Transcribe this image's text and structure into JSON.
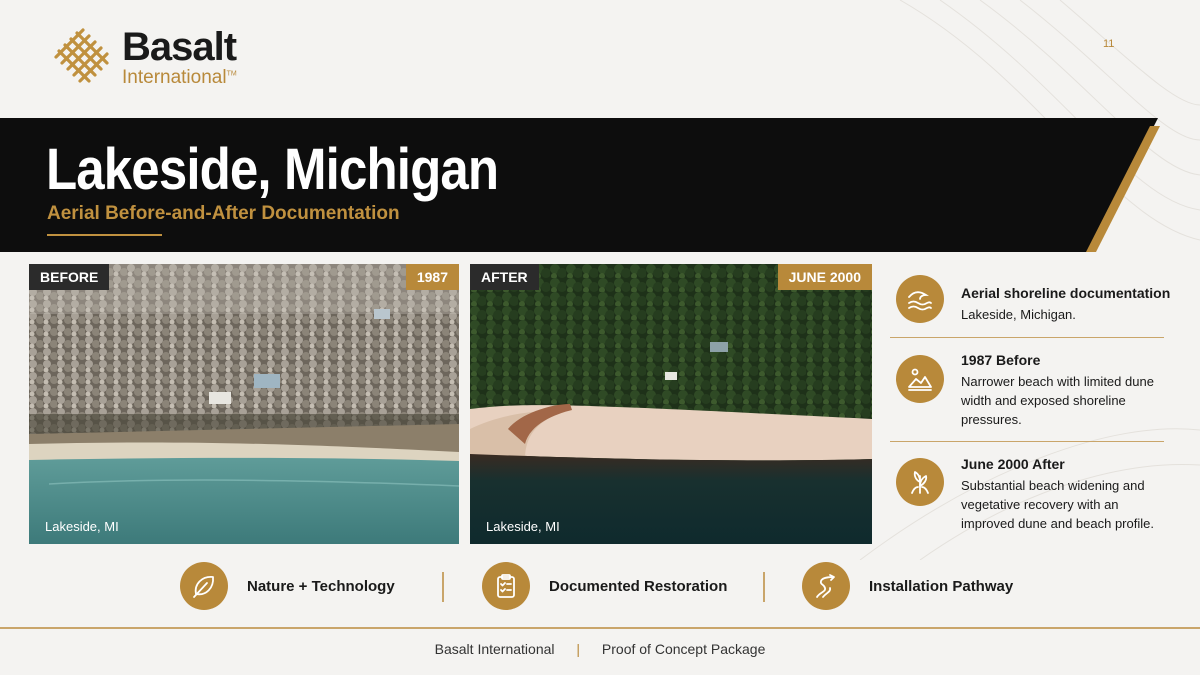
{
  "brand": {
    "name": "Basalt",
    "sub": "International",
    "tm": "TM",
    "accent": "#b8893a"
  },
  "page_number": "11",
  "header": {
    "title": "Lakeside, Michigan",
    "subtitle": "Aerial Before-and-After Documentation"
  },
  "photos": {
    "before": {
      "tag": "BEFORE",
      "year": "1987",
      "caption": "Lakeside, MI"
    },
    "after": {
      "tag": "AFTER",
      "year": "JUNE 2000",
      "caption": "Lakeside, MI"
    }
  },
  "side_items": [
    {
      "icon": "wave-icon",
      "heading": "Aerial shoreline documentation",
      "body": "Lakeside, Michigan."
    },
    {
      "icon": "dune-icon",
      "heading": "1987 Before",
      "body": "Narrower beach with limited dune width and exposed shoreline pressures."
    },
    {
      "icon": "plant-icon",
      "heading": "June 2000 After",
      "body": "Substantial beach widening and vegetative recovery with an improved dune and beach profile."
    }
  ],
  "features": [
    {
      "icon": "leaf-icon",
      "label": "Nature + Technology"
    },
    {
      "icon": "clipboard-icon",
      "label": "Documented Restoration"
    },
    {
      "icon": "pathway-icon",
      "label": "Installation Pathway"
    }
  ],
  "footer": {
    "left": "Basalt International",
    "separator": "|",
    "right": "Proof of Concept Package"
  }
}
